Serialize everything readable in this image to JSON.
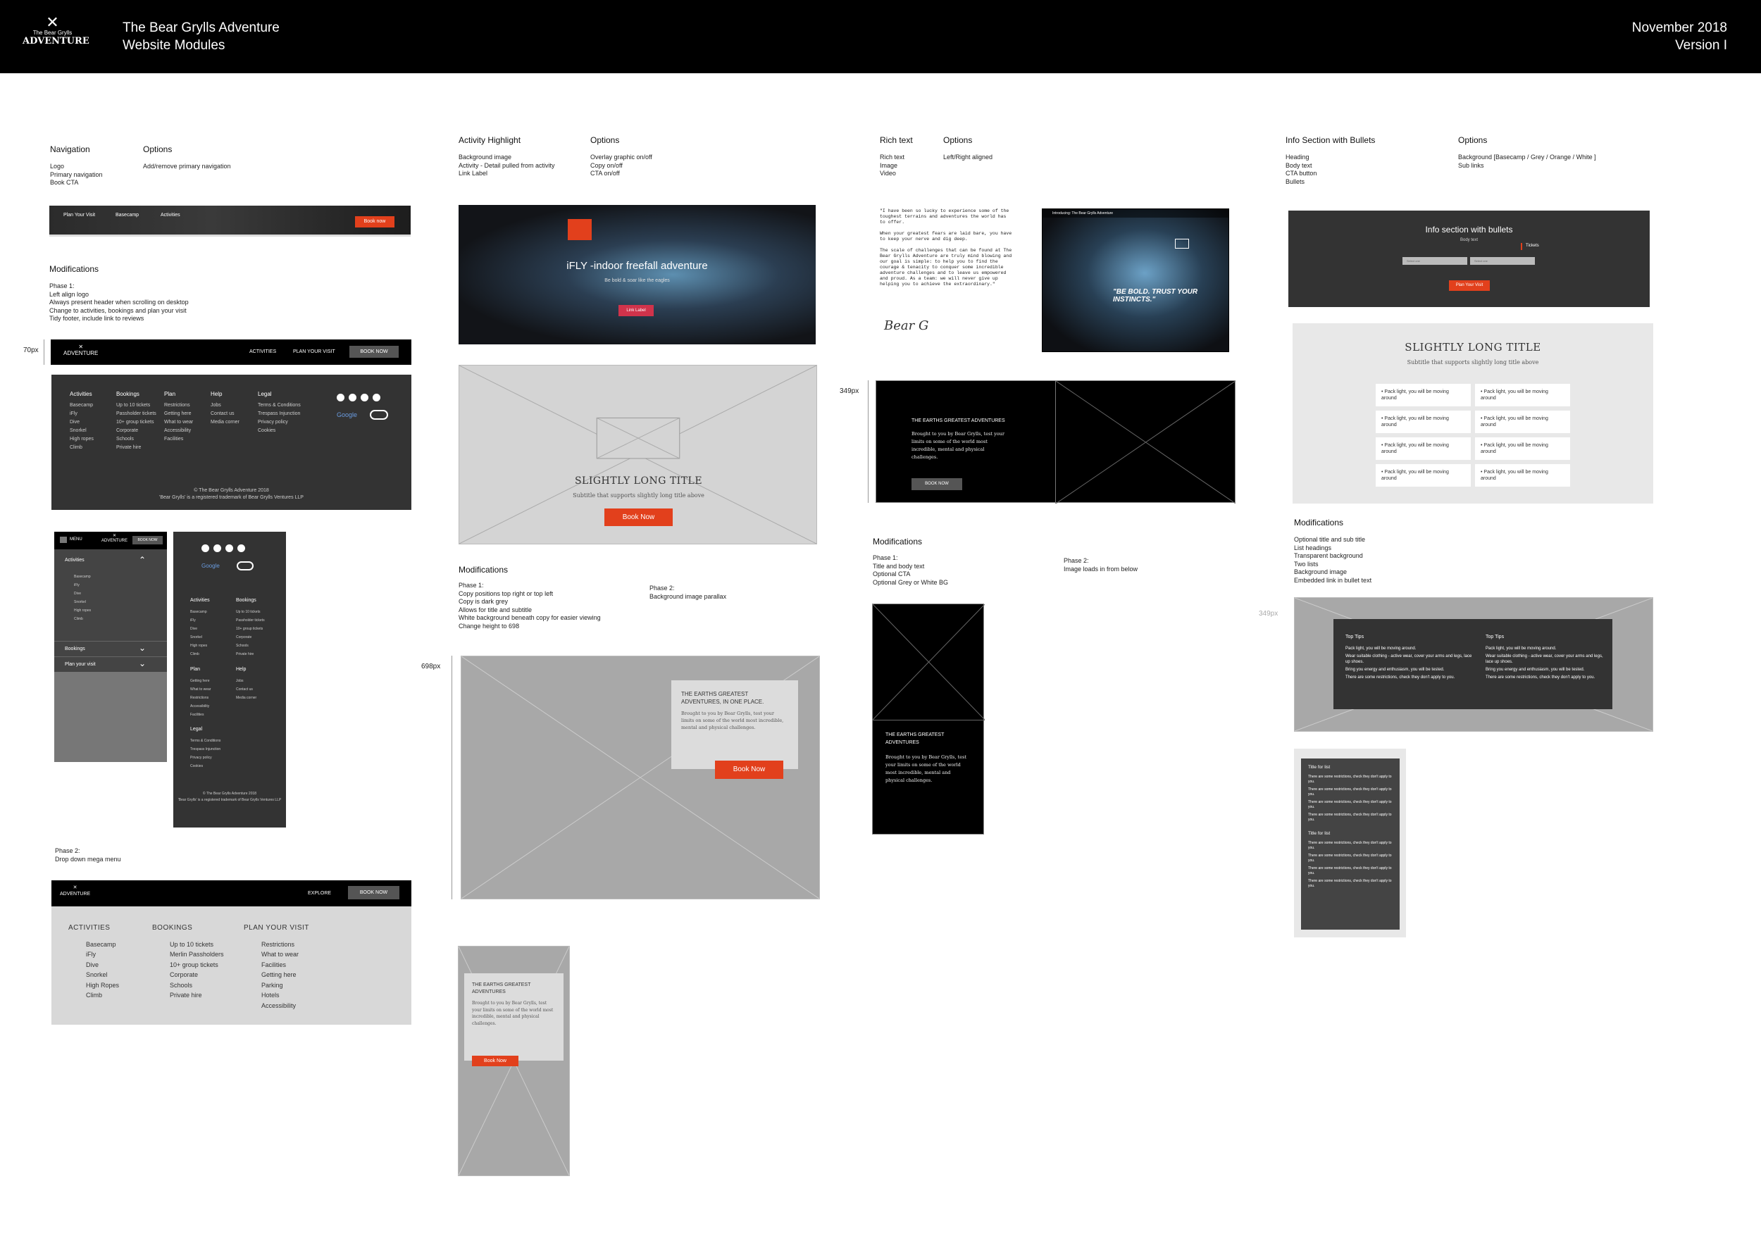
{
  "header": {
    "logo_line1": "The Bear Grylls",
    "logo_line2": "ADVENTURE",
    "title_line1": "The Bear Grylls Adventure",
    "title_line2": "Website Modules",
    "date": "November 2018",
    "version": "Version I"
  },
  "navigation": {
    "heading": "Navigation",
    "items": "Logo\nPrimary navigation\nBook CTA",
    "options_heading": "Options",
    "options": "Add/remove primary navigation",
    "preview": {
      "links": [
        "Plan Your Visit",
        "Basecamp",
        "Activities"
      ],
      "cta": "Book now"
    },
    "mods_heading": "Modifications",
    "phase1": "Phase 1:\nLeft align logo\nAlways present header when scrolling on desktop\nChange to activities, bookings and plan your visit\nTidy footer, include link to reviews",
    "height_label": "70px",
    "desktop_nav": {
      "activities": "ACTIVITIES",
      "plan": "PLAN YOUR VISIT",
      "cta": "BOOK NOW"
    },
    "footer": {
      "cols": [
        {
          "title": "Activities",
          "items": "Basecamp\niFly\nDive\nSnorkel\nHigh ropes\nClimb"
        },
        {
          "title": "Bookings",
          "items": "Up to 10 tickets\nPassholder tickets\n10+ group tickets\nCorporate\nSchools\nPrivate hire"
        },
        {
          "title": "Plan",
          "items": "Restrictions\nGetting here\nWhat to wear\nAccessibility\nFacilities"
        },
        {
          "title": "Help",
          "items": "Jobs\nContact us\nMedia corner"
        },
        {
          "title": "Legal",
          "items": "Terms & Conditions\nTrespass Injunction\nPrivacy policy\nCookies"
        }
      ],
      "copyright": "© The Bear Grylls Adventure 2018\n'Bear Grylls' is a registered trademark of Bear Grylls Ventures LLP",
      "google": "Google"
    },
    "mobile_menu": {
      "menu": "MENU",
      "cta": "BOOK NOW",
      "activities": "Activities",
      "activity_items": "Basecamp\niFly\nDive\nSnorkel\nHigh ropes\nClimb",
      "bookings": "Bookings",
      "plan": "Plan your visit"
    },
    "mobile_footer": {
      "cols": [
        {
          "title": "Activities",
          "items": "Basecamp\niFly\nDive\nSnorkel\nHigh ropes\nClimb"
        },
        {
          "title": "Bookings",
          "items": "Up to 10 tickets\nPassholder tickets\n10+ group tickets\nCorporate\nSchools\nPrivate hire"
        },
        {
          "title": "Plan",
          "items": "Getting here\nWhat to wear\nRestrictions\nAccessibility\nFacilities"
        },
        {
          "title": "Help",
          "items": "Jobs\nContact us\nMedia corner"
        },
        {
          "title": "Legal",
          "items": "Terms & Conditions\nTrespass Injunction\nPrivacy policy\nCookies"
        }
      ],
      "copyright": "© The Bear Grylls Adventure 2018\n'Bear Grylls' is a registered trademark of Bear Grylls Ventures LLP"
    },
    "phase2": "Phase 2:\nDrop down mega menu",
    "mega": {
      "explore": "EXPLORE",
      "cta": "BOOK NOW",
      "cols": [
        {
          "title": "ACTIVITIES",
          "items": "Basecamp\niFly\nDive\nSnorkel\nHigh Ropes\nClimb"
        },
        {
          "title": "BOOKINGS",
          "items": "Up to 10 tickets\nMerlin Passholders\n10+ group tickets\nCorporate\nSchools\nPrivate hire"
        },
        {
          "title": "PLAN YOUR VISIT",
          "items": "Restrictions\nWhat to wear\nFacilities\nGetting here\nParking\nHotels\nAccessibility"
        }
      ]
    }
  },
  "activity": {
    "heading": "Activity Highlight",
    "items": "Background image\nActivity - Detail pulled from activity\nLink Label",
    "options_heading": "Options",
    "options": "Overlay graphic on/off\nCopy on/off\nCTA on/off",
    "hero": {
      "title": "iFLY -indoor freefall adventure",
      "sub": "Be bold & soar like the eagles",
      "cta": "Link Label"
    },
    "wire": {
      "title": "SLIGHTLY LONG TITLE",
      "sub": "Subtitle that supports slightly long title above",
      "cta": "Book Now"
    },
    "mods_heading": "Modifications",
    "phase1": "Phase 1:\nCopy positions top right or top left\nCopy is dark grey\nAllows for title and subtitle\nWhite background beneath copy for easier viewing\nChange height to 698",
    "phase2": "Phase 2:\nBackground image parallax",
    "height_label": "698px",
    "panel": {
      "title": "THE EARTHS GREATEST ADVENTURES, IN ONE PLACE.",
      "body": "Brought to you by Bear Grylls, test your limits on some of the world most incredible, mental and physical challenges.",
      "cta": "Book Now"
    },
    "mobile": {
      "title": "THE EARTHS GREATEST ADVENTURES",
      "body": "Brought to you by Bear Grylls, test your limits on some of the world most incredible, mental and physical challenges.",
      "cta": "Book Now"
    }
  },
  "richtext": {
    "heading": "Rich text",
    "items": "Rich text\nImage\nVideo",
    "options_heading": "Options",
    "options": "Left/Right aligned",
    "quote": "\"I have been so lucky to experience some of the toughest terrains and adventures the world has to offer.\n\nWhen your greatest fears are laid bare, you have to keep your nerve and dig deep.\n\nThe scale of challenges that can be found at The Bear Grylls Adventure are truly mind blowing and our goal is simple: to help you to find the courage & tenacity to conquer some incredible adventure challenges and to leave us empowered and proud.  As a team: we will never give up helping you to achieve the extraordinary.\"",
    "signature": "Bear G",
    "video_title": "Introducing: The Bear Grylls Adventure",
    "video_caption": "\"BE BOLD. TRUST YOUR INSTINCTS.\"",
    "height_label": "349px",
    "block": {
      "title": "THE EARTHS GREATEST ADVENTURES",
      "body": "Brought to you by Bear Grylls, test your limits on some of the world most incredible, mental and physical challenges.",
      "cta": "BOOK NOW"
    },
    "mods_heading": "Modifications",
    "phase1": "Phase 1:\nTitle and body text\nOptional CTA\nOptional Grey or White BG",
    "phase2": "Phase 2:\nImage loads in from below",
    "mobile": {
      "title": "THE EARTHS GREATEST ADVENTURES",
      "body": "Brought to you by Bear Grylls, test your limits on some of the world most incredible, mental and physical challenges."
    }
  },
  "info": {
    "heading": "Info Section with Bullets",
    "items": "Heading\nBody text\nCTA button\nBullets",
    "options_heading": "Options",
    "options": "Background [Basecamp / Grey / Orange / White ]\nSub links",
    "dark": {
      "title": "Info section with bullets",
      "sub": "Body text",
      "tickets": "Tickets",
      "field1": "Select one",
      "field2": "Select one",
      "cta": "Plan Your Visit"
    },
    "light": {
      "title": "SLIGHTLY LONG TITLE",
      "sub": "Subtitle that supports slightly long title above",
      "bullet": "Pack light, you will be moving around"
    },
    "mods_heading": "Modifications",
    "mods": "Optional title and sub title\nList headings\nTransparent background\nTwo lists\nBackground image\nEmbedded link in bullet text",
    "height_label": "349px",
    "tips": {
      "heading": "Top Tips",
      "items": [
        "Pack light, you will be moving around.",
        "Wear suitable clothing - active wear, cover your arms and legs, lace up shoes.",
        "Bring you energy and enthusiasm, you will be tested.",
        "There are some restrictions, check they don't apply to you."
      ]
    },
    "mobile": {
      "list_title": "Title for list",
      "item": "There are some restrictions, check they don't apply to you."
    }
  }
}
